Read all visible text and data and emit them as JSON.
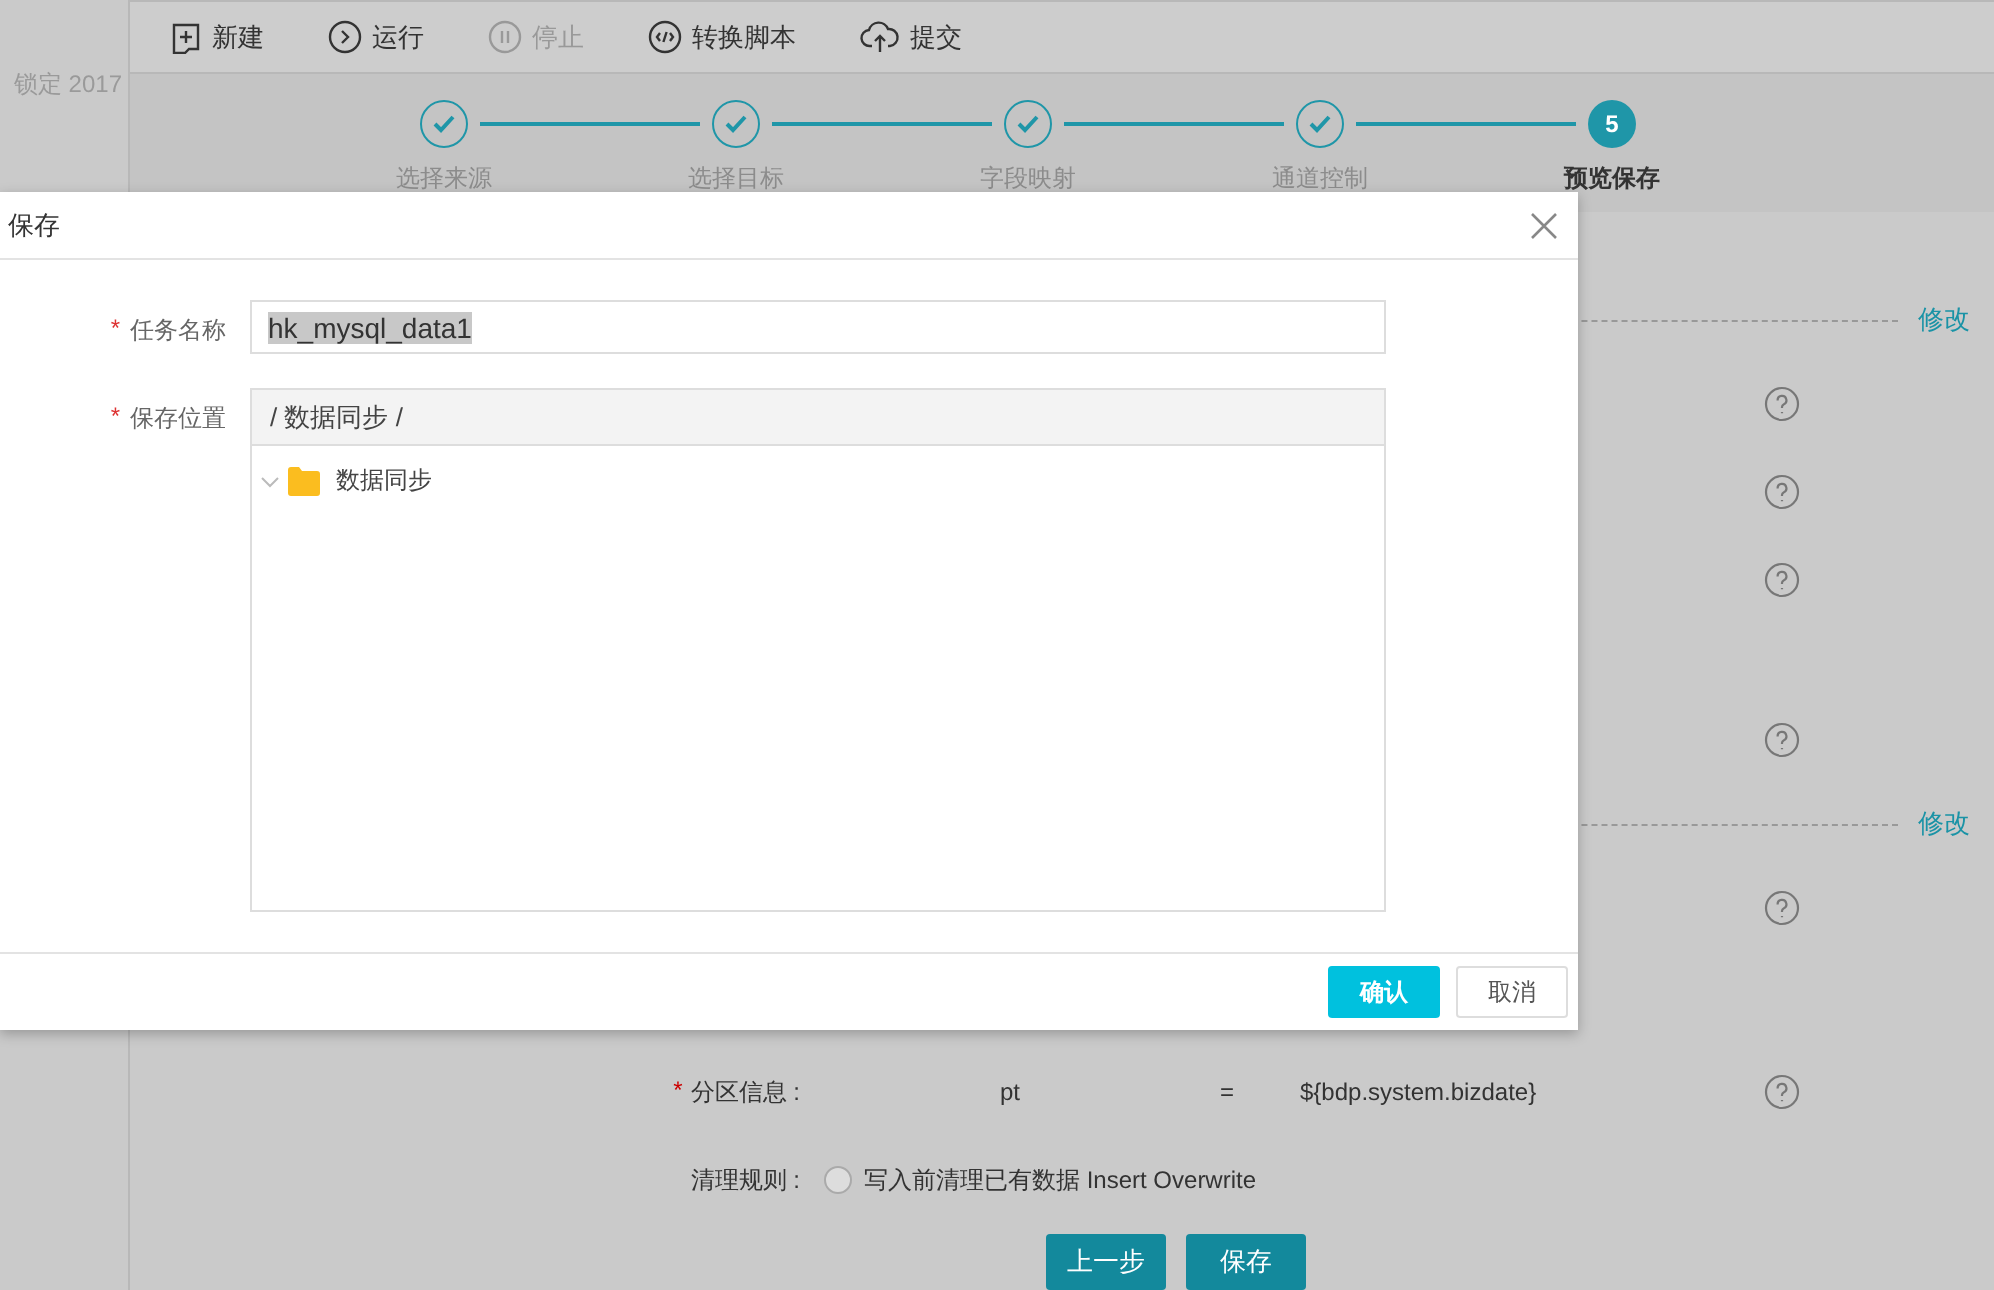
{
  "sidebar": {
    "text": "锁定 2017"
  },
  "toolbar": [
    {
      "label": "新建",
      "disabled": false
    },
    {
      "label": "运行",
      "disabled": false
    },
    {
      "label": "停止",
      "disabled": true
    },
    {
      "label": "转换脚本",
      "disabled": false
    },
    {
      "label": "提交",
      "disabled": false
    }
  ],
  "steps": [
    {
      "label": "选择来源",
      "done": true,
      "selected": false
    },
    {
      "label": "选择目标",
      "done": true,
      "selected": false
    },
    {
      "label": "字段映射",
      "done": true,
      "selected": false
    },
    {
      "label": "通道控制",
      "done": true,
      "selected": false
    },
    {
      "label": "预览保存",
      "number": "5",
      "done": false,
      "selected": true
    }
  ],
  "background": {
    "rows": [
      {
        "kind": "section",
        "link": "修改"
      },
      {
        "kind": "help"
      },
      {
        "kind": "help"
      },
      {
        "kind": "help"
      },
      {
        "kind": "help"
      },
      {
        "kind": "section",
        "link": "修改"
      },
      {
        "kind": "help"
      },
      {
        "kind": "partition",
        "required": "*",
        "label": "分区信息 :",
        "key": "pt",
        "operator": "=",
        "value": "${bdp.system.bizdate}"
      },
      {
        "kind": "radio",
        "label": "清理规则 :",
        "option": "写入前清理已有数据 Insert Overwrite",
        "checked": false
      }
    ],
    "buttons": [
      "上一步",
      "保存"
    ]
  },
  "dialog": {
    "title": "保存",
    "fields": [
      {
        "kind": "input",
        "label": "任务名称",
        "required": "*",
        "value": "hk_mysql_data1"
      },
      {
        "kind": "tree",
        "label": "保存位置",
        "required": "*",
        "path": "/ 数据同步 /",
        "nodes": [
          {
            "label": "数据同步",
            "expanded": false
          }
        ]
      }
    ],
    "buttons": [
      {
        "label": "确认",
        "primary": true
      },
      {
        "label": "取消",
        "primary": false
      }
    ]
  }
}
